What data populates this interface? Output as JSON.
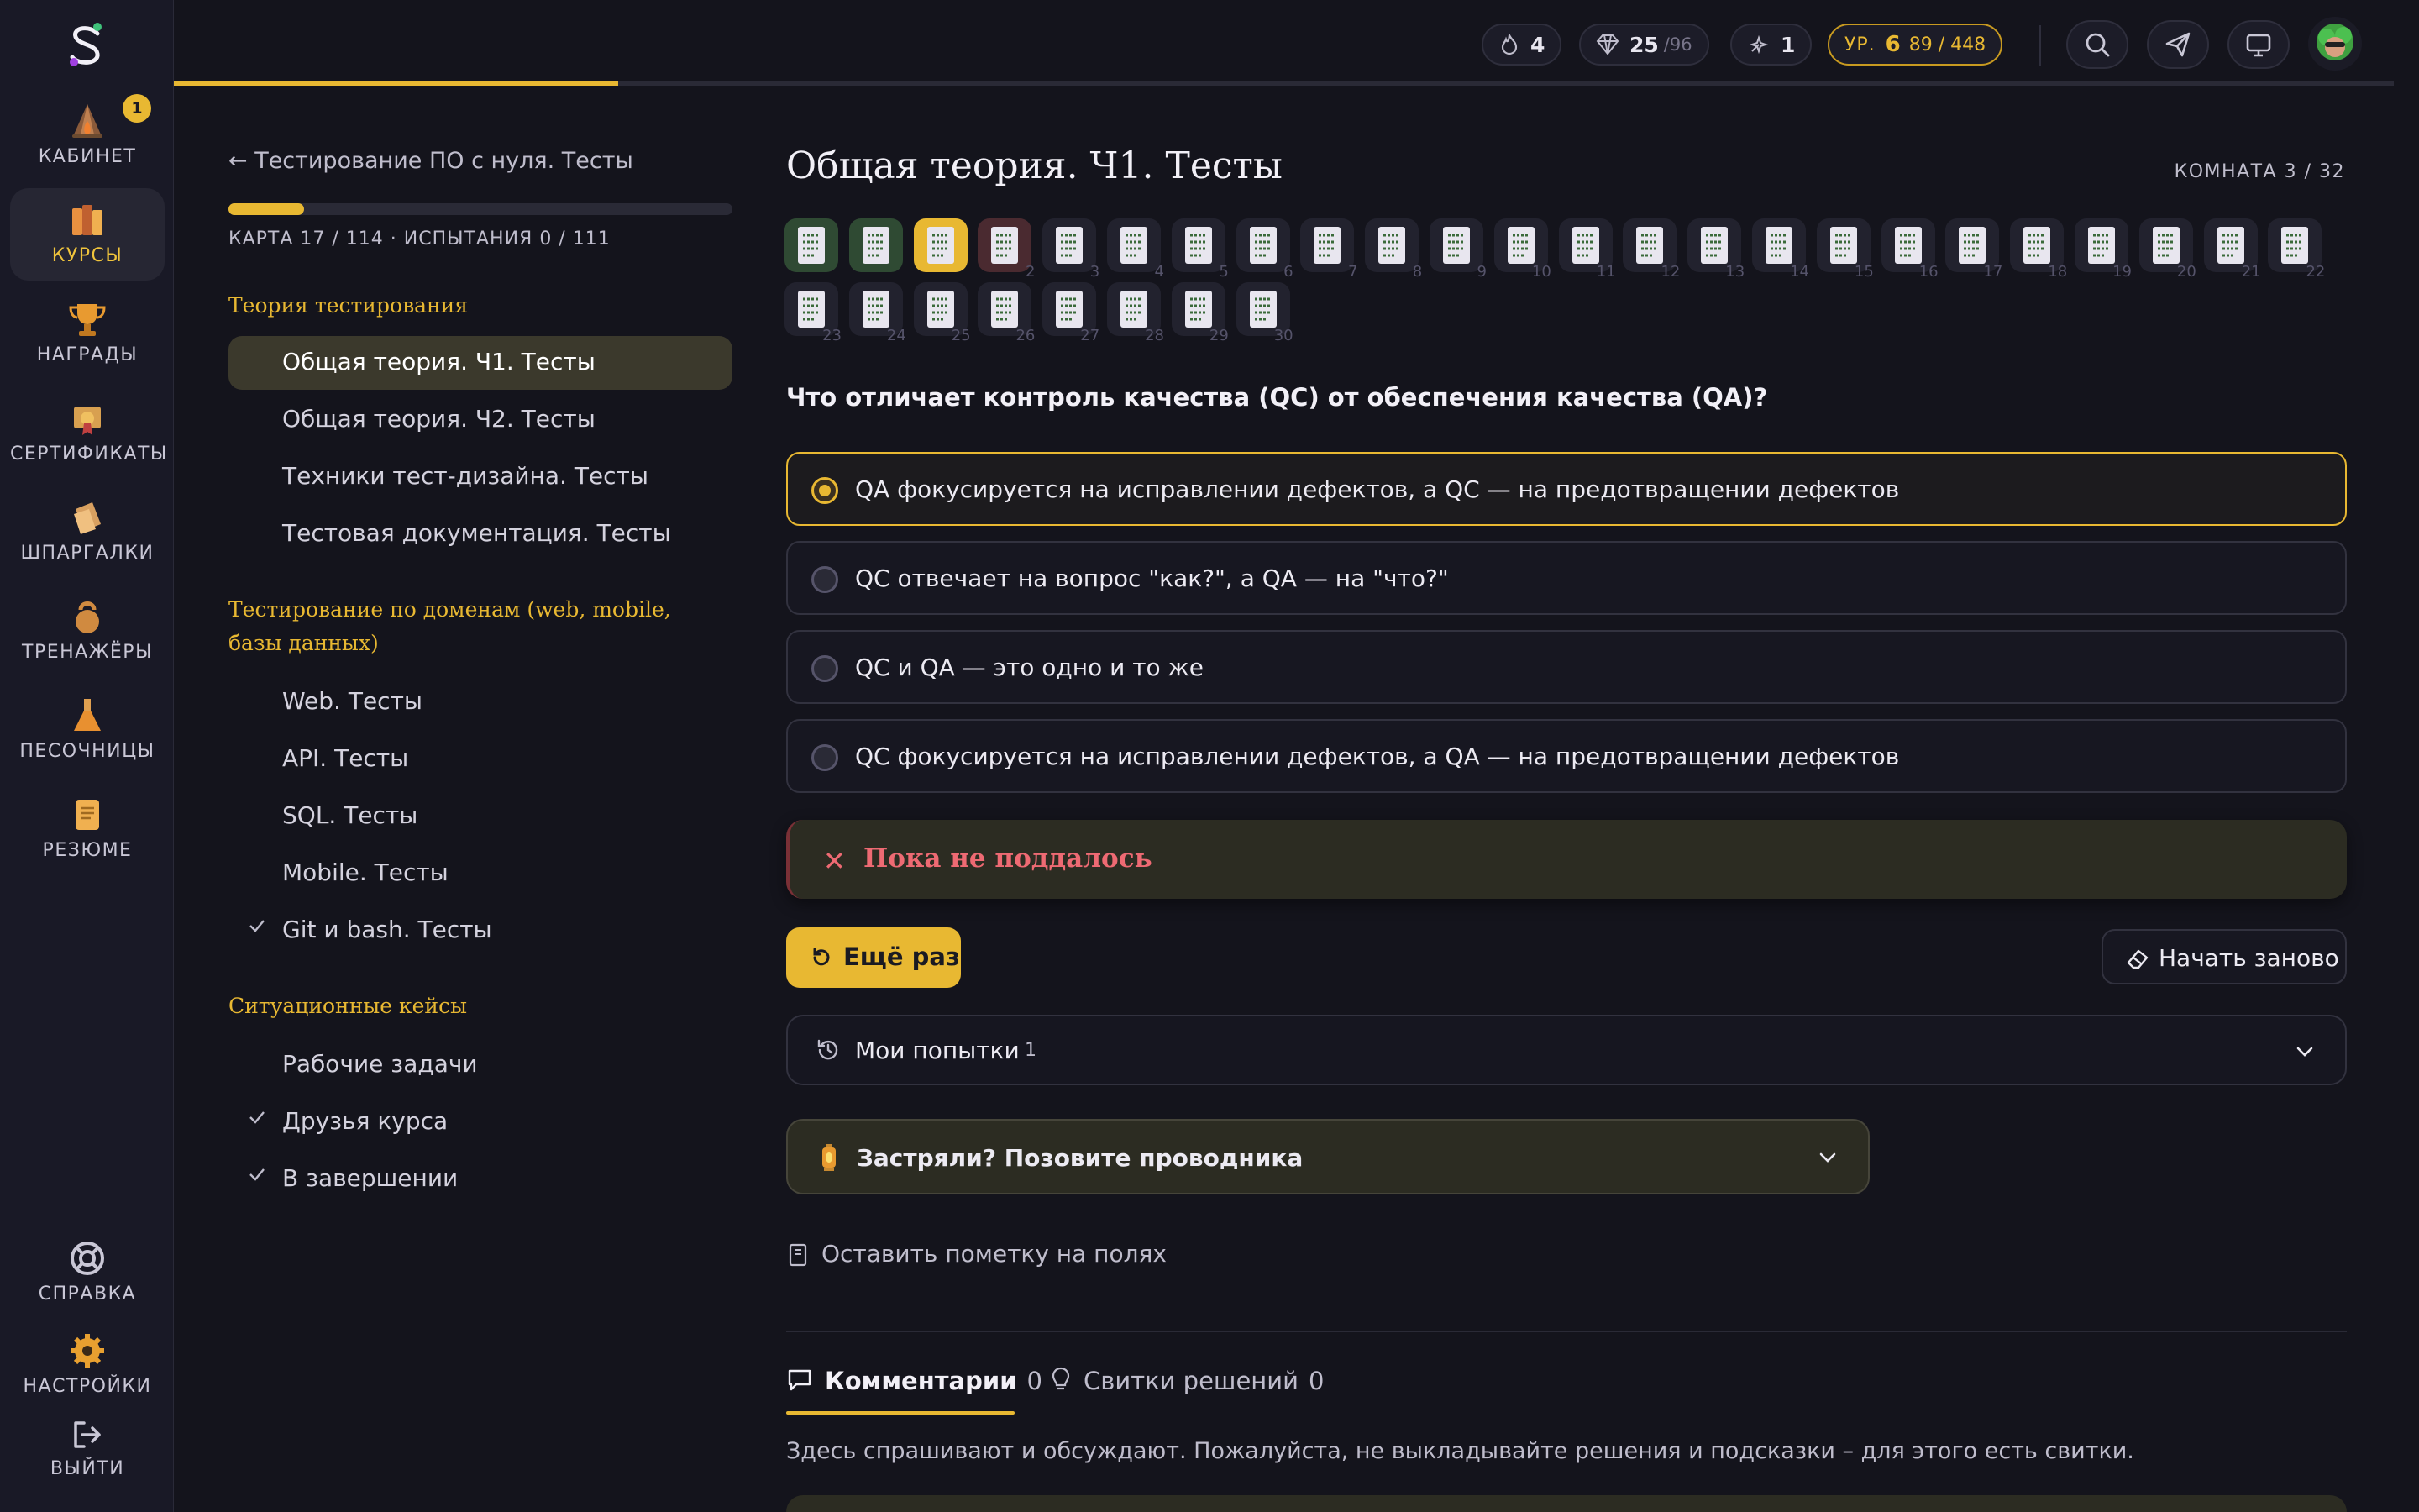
{
  "sidebar": {
    "items": [
      {
        "label": "КАБИНЕТ",
        "badge": "1"
      },
      {
        "label": "КУРСЫ"
      },
      {
        "label": "НАГРАДЫ"
      },
      {
        "label": "СЕРТИФИКАТЫ"
      },
      {
        "label": "ШПАРГАЛКИ"
      },
      {
        "label": "ТРЕНАЖЁРЫ"
      },
      {
        "label": "ПЕСОЧНИЦЫ"
      },
      {
        "label": "РЕЗЮМЕ"
      }
    ],
    "bottom": [
      {
        "label": "СПРАВКА"
      },
      {
        "label": "НАСТРОЙКИ"
      },
      {
        "label": "ВЫЙТИ"
      }
    ]
  },
  "topbar": {
    "streak": "4",
    "gems": "25",
    "gems_max": "/96",
    "boost": "1",
    "level_prefix": "УР.",
    "level": "6",
    "xp": "89 / 448",
    "progress": 0.2
  },
  "course": {
    "back_label": "← Тестирование ПО с нуля. Тесты",
    "map_info": "КАРТА 17 / 114 · ИСПЫТАНИЯ 0 / 111",
    "map_progress": 0.15,
    "sections": [
      {
        "title": "Теория тестирования",
        "items": [
          {
            "label": "Общая теория. Ч1. Тесты",
            "active": true
          },
          {
            "label": "Общая теория. Ч2. Тесты"
          },
          {
            "label": "Техники тест-дизайна. Тесты"
          },
          {
            "label": "Тестовая документация. Тесты"
          }
        ]
      },
      {
        "title": "Тестирование по доменам (web, mobile, базы данных)",
        "items": [
          {
            "label": "Web. Тесты"
          },
          {
            "label": "API. Тесты"
          },
          {
            "label": "SQL. Тесты"
          },
          {
            "label": "Mobile. Тесты"
          },
          {
            "label": "Git и bash. Тесты",
            "done": true
          }
        ]
      },
      {
        "title": "Ситуационные кейсы",
        "items": [
          {
            "label": "Рабочие задачи"
          },
          {
            "label": "Друзья курса",
            "done": true
          },
          {
            "label": "В завершении",
            "done": true
          }
        ]
      }
    ]
  },
  "lesson": {
    "title": "Общая теория. Ч1. Тесты",
    "room": "КОМНАТА 3 / 32",
    "tiles": [
      {
        "n": "",
        "s": "g"
      },
      {
        "n": "",
        "s": "g"
      },
      {
        "n": "",
        "s": "y"
      },
      {
        "n": "2",
        "s": "r"
      },
      {
        "n": "3",
        "s": ""
      },
      {
        "n": "4",
        "s": ""
      },
      {
        "n": "5",
        "s": ""
      },
      {
        "n": "6",
        "s": ""
      },
      {
        "n": "7",
        "s": ""
      },
      {
        "n": "8",
        "s": ""
      },
      {
        "n": "9",
        "s": ""
      },
      {
        "n": "10",
        "s": ""
      },
      {
        "n": "11",
        "s": ""
      },
      {
        "n": "12",
        "s": ""
      },
      {
        "n": "13",
        "s": ""
      },
      {
        "n": "14",
        "s": ""
      },
      {
        "n": "15",
        "s": ""
      },
      {
        "n": "16",
        "s": ""
      },
      {
        "n": "17",
        "s": ""
      },
      {
        "n": "18",
        "s": ""
      },
      {
        "n": "19",
        "s": ""
      },
      {
        "n": "20",
        "s": ""
      },
      {
        "n": "21",
        "s": ""
      },
      {
        "n": "22",
        "s": ""
      },
      {
        "n": "23",
        "s": ""
      },
      {
        "n": "24",
        "s": ""
      },
      {
        "n": "25",
        "s": ""
      },
      {
        "n": "26",
        "s": ""
      },
      {
        "n": "27",
        "s": ""
      },
      {
        "n": "28",
        "s": ""
      },
      {
        "n": "29",
        "s": ""
      },
      {
        "n": "30",
        "s": ""
      }
    ],
    "question": "Что отличает контроль качества (QC) от обеспечения качества (QA)?",
    "options": [
      {
        "text": "QA фокусируется на исправлении дефектов, а QC — на предотвращении дефектов",
        "selected": true
      },
      {
        "text": "QC отвечает на вопрос \"как?\", а QA — на \"что?\""
      },
      {
        "text": "QC и QA — это одно и то же"
      },
      {
        "text": "QC фокусируется на исправлении дефектов, а QA — на предотвращении дефектов"
      }
    ],
    "result_icon": "✕",
    "result_text": "Пока не поддалось",
    "retry_label": "Ещё раз",
    "restart_label": "Начать заново",
    "attempts_label": "Мои попытки",
    "attempts_count": "1",
    "guide_label": "Застряли? Позовите проводника",
    "note_label": "Оставить пометку на полях",
    "tabs": [
      {
        "label": "Комментарии",
        "count": "0"
      },
      {
        "label": "Свитки решений",
        "count": "0"
      }
    ],
    "hint": "Здесь спрашивают и обсуждают. Пожалуйста, не выкладывайте решения и подсказки – для этого есть свитки."
  },
  "colors": {
    "accent": "#e8b832",
    "bg": "#14141c",
    "error": "#ee6a73"
  }
}
